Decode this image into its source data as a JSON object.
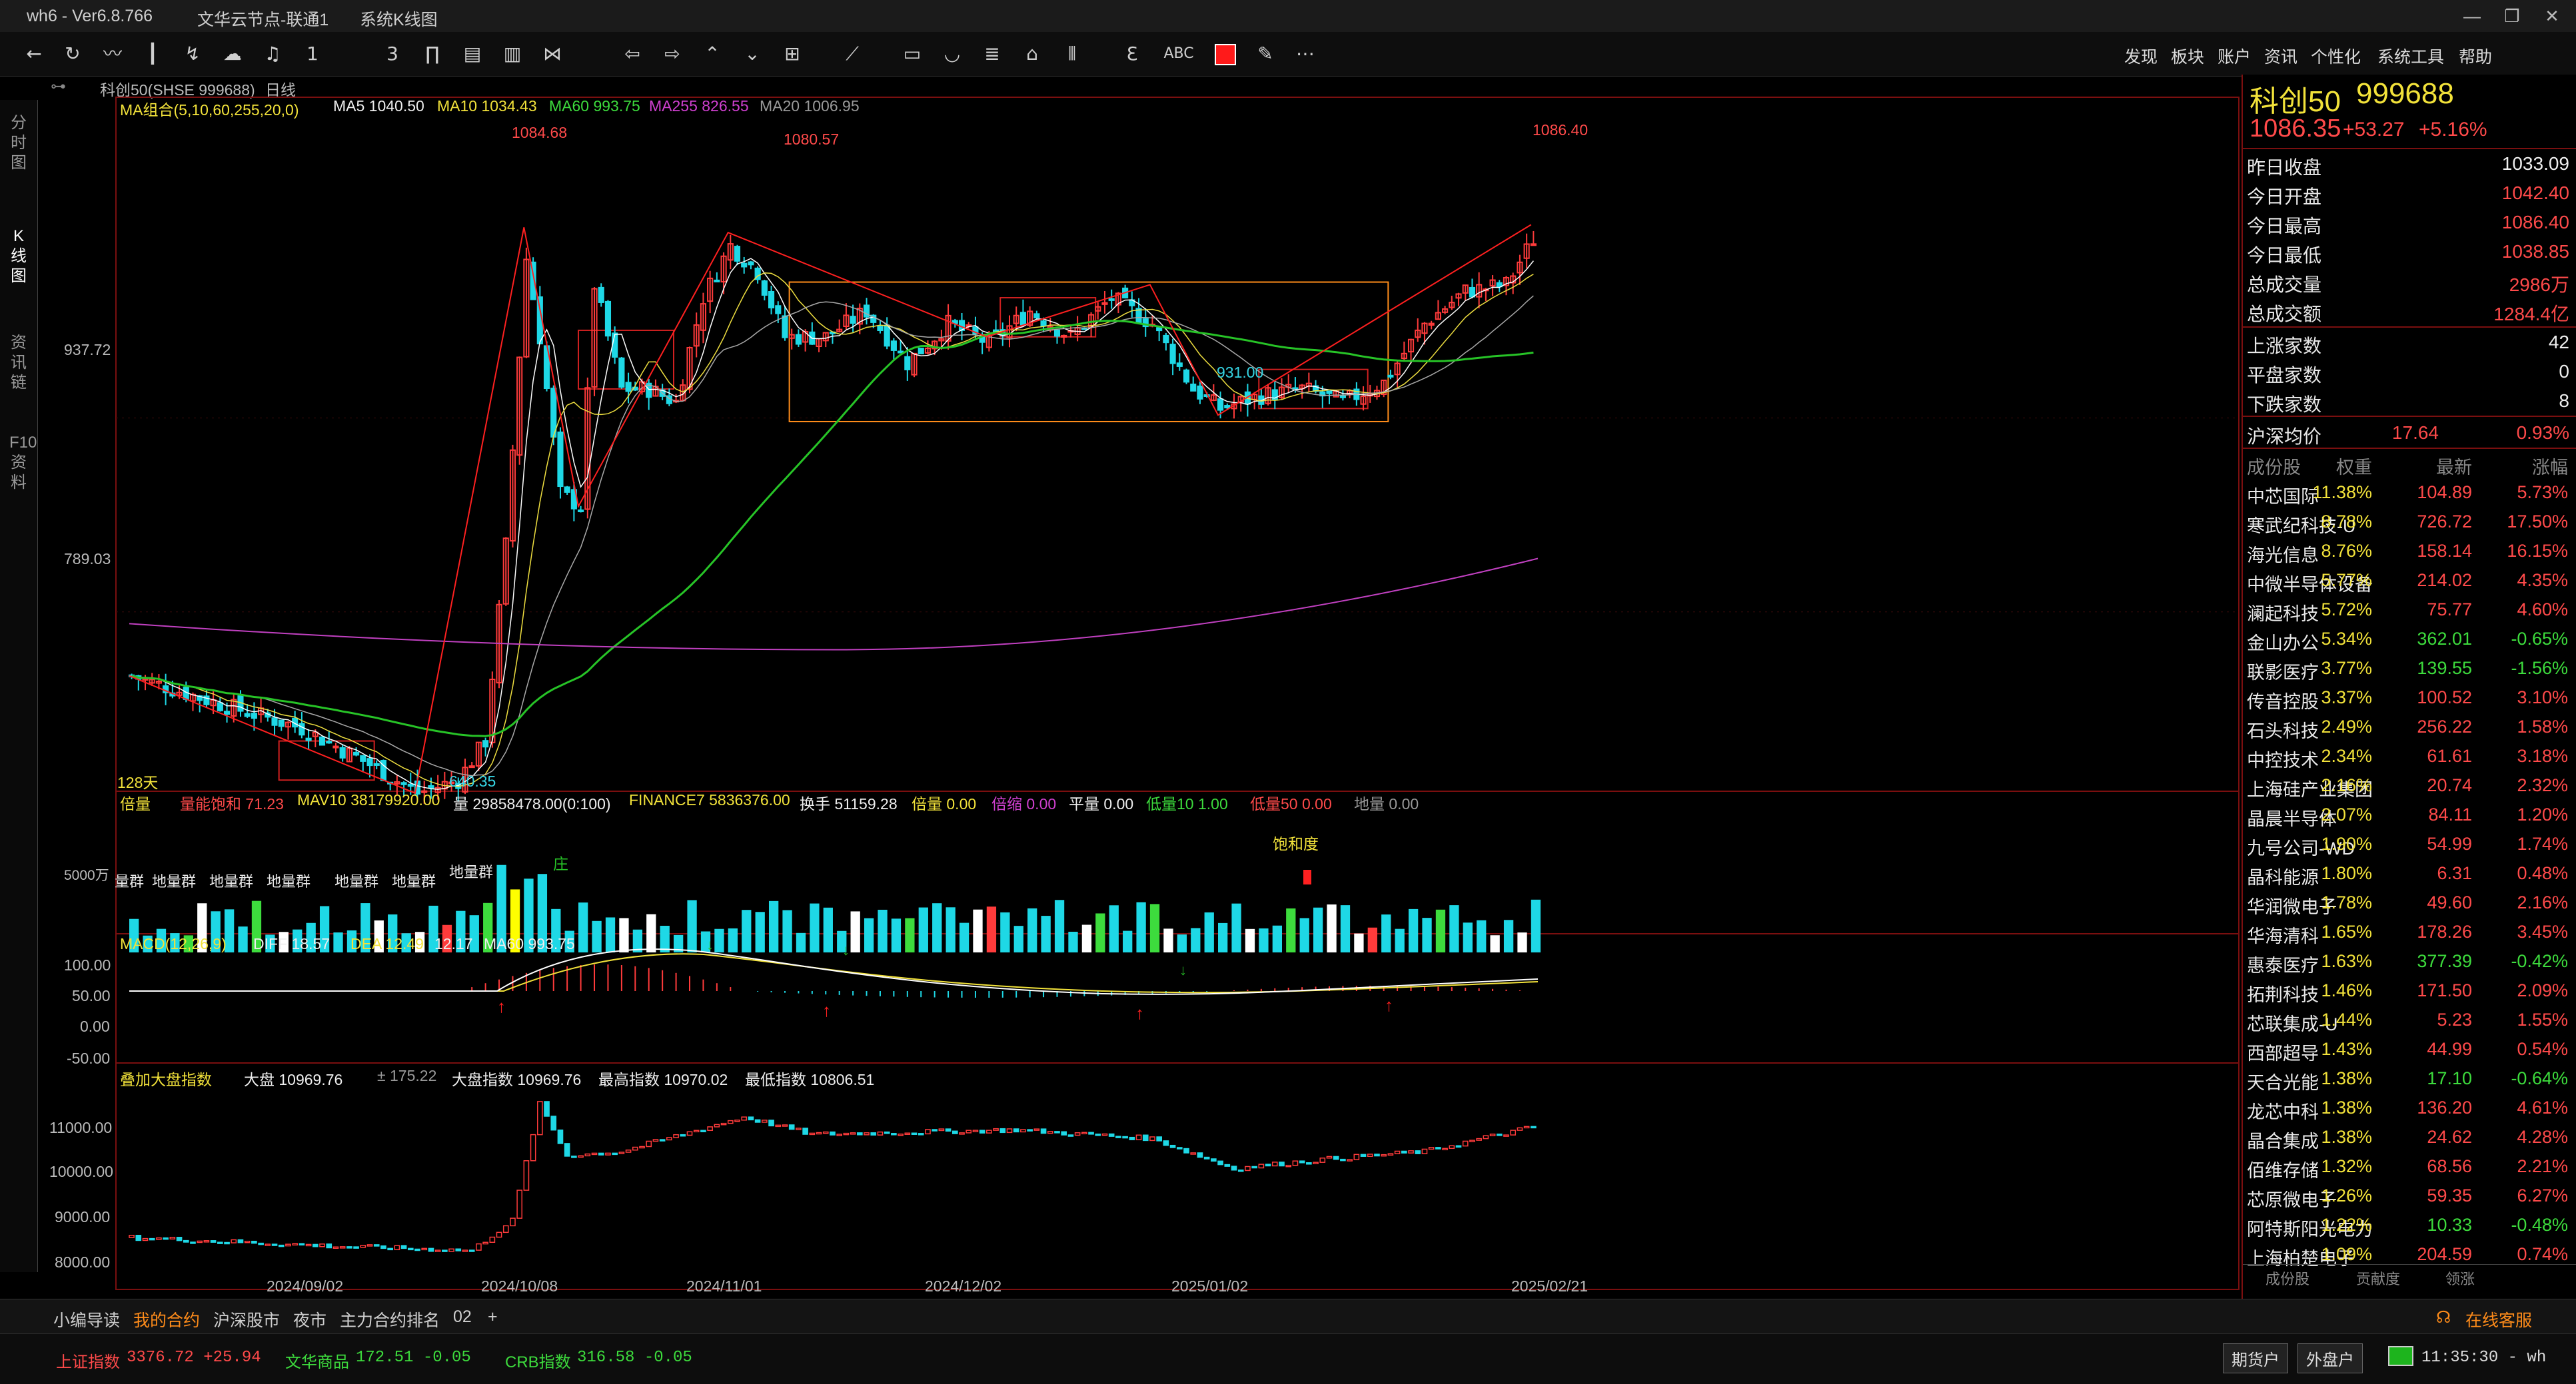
{
  "titlebar": {
    "app": "wh6 - Ver6.8.766",
    "node": "文华云节点-联通1",
    "module": "系统K线图",
    "controls": [
      "—",
      "❐",
      "✕"
    ]
  },
  "toolbar": {
    "icons": [
      "back-icon",
      "refresh-icon",
      "line-icon",
      "candle-icon",
      "tick-icon",
      "cloud-icon",
      "bell-icon",
      "num1-icon",
      "num3-icon",
      "period-icon",
      "season-icon",
      "year-icon",
      "expand-icon",
      "arrow-left-icon",
      "arrow-right-icon",
      "arrow-up-icon",
      "arrow-down-icon",
      "crosshair-icon",
      "draw-line-icon",
      "rect-icon",
      "arc-icon",
      "ruler-icon",
      "home-icon",
      "bars-icon",
      "text-e-icon",
      "abc-icon",
      "color-icon",
      "eraser-icon",
      "more-icon"
    ],
    "menu": [
      "发现",
      "板块",
      "账户",
      "资讯",
      "个性化",
      "系统工具",
      "帮助"
    ]
  },
  "left_tabs": [
    "分时图",
    "K线图",
    "资讯链",
    "F10资料"
  ],
  "chart_header": {
    "symbol": "科创50(SHSE 999688)",
    "period": "日线",
    "ma_group": "MA组合(5,10,60,255,20,0)",
    "ma5": "MA5 1040.50",
    "ma10": "MA10 1034.43",
    "ma60": "MA60 993.75",
    "ma255": "MA255 826.55",
    "ma20": "MA20 1006.95"
  },
  "price_axis": [
    "937.72",
    "789.03"
  ],
  "annotations": {
    "high1": "1084.68",
    "high2": "1080.57",
    "high3": "1086.40",
    "low1": "931.00",
    "low2": "640.35",
    "days": "128天"
  },
  "volume_header": {
    "name": "倍量",
    "a": "量能饱和 71.23",
    "b": "MAV10 38179920.00",
    "c": "量 29858478.00(0:100)",
    "d": "FINANCE7 5836376.00",
    "e": "换手 51159.28",
    "f": "倍量 0.00",
    "g": "倍缩 0.00",
    "h": "平量 0.00",
    "i": "低量10 1.00",
    "j": "低量50 0.00",
    "k": "地量 0.00",
    "axis": "5000万",
    "sat": "饱和度",
    "groups": [
      "量群",
      "地量群",
      "地量群",
      "地量群",
      "地量群",
      "地量群",
      "地量群"
    ],
    "zhuang": "庄"
  },
  "macd_header": {
    "name": "MACD(12,26,9)",
    "diff": "DIFF 18.57",
    "dea": "DEA 12.49",
    "val": "12.17",
    "ma60": "MA60 993.75",
    "axis": [
      "100.00",
      "50.00",
      "0.00",
      "-50.00"
    ]
  },
  "index_header": {
    "name": "叠加大盘指数",
    "a": "大盘 10969.76",
    "b": "± 175.22",
    "c": "大盘指数 10969.76",
    "d": "最高指数 10970.02",
    "e": "最低指数 10806.51",
    "axis": [
      "11000.00",
      "10000.00",
      "9000.00",
      "8000.00"
    ]
  },
  "dates": [
    "2024/09/02",
    "2024/10/08",
    "2024/11/01",
    "2024/12/02",
    "2025/01/02",
    "2025/02/21"
  ],
  "quote": {
    "name": "科创50",
    "code": "999688",
    "price": "1086.35",
    "change": "+53.27",
    "pct": "+5.16%",
    "rows": [
      {
        "k": "昨日收盘",
        "v": "1033.09",
        "cls": "white"
      },
      {
        "k": "今日开盘",
        "v": "1042.40",
        "cls": "red"
      },
      {
        "k": "今日最高",
        "v": "1086.40",
        "cls": "red"
      },
      {
        "k": "今日最低",
        "v": "1038.85",
        "cls": "red"
      },
      {
        "k": "总成交量",
        "v": "2986万",
        "cls": "red"
      },
      {
        "k": "总成交额",
        "v": "1284.4亿",
        "cls": "red"
      }
    ],
    "rows2": [
      {
        "k": "上涨家数",
        "v": "42",
        "cls": "white"
      },
      {
        "k": "平盘家数",
        "v": "0",
        "cls": "white"
      },
      {
        "k": "下跌家数",
        "v": "8",
        "cls": "white"
      }
    ],
    "avg_label": "沪深均价",
    "avg_price": "17.64",
    "avg_pct": "0.93%"
  },
  "components_header": [
    "成份股",
    "权重",
    "最新",
    "涨幅"
  ],
  "components": [
    {
      "n": "中芯国际",
      "w": "11.38%",
      "p": "104.89",
      "c": "5.73%",
      "up": true
    },
    {
      "n": "寒武纪科技-U",
      "w": "8.78%",
      "p": "726.72",
      "c": "17.50%",
      "up": true
    },
    {
      "n": "海光信息",
      "w": "8.76%",
      "p": "158.14",
      "c": "16.15%",
      "up": true
    },
    {
      "n": "中微半导体设备",
      "w": "5.77%",
      "p": "214.02",
      "c": "4.35%",
      "up": true
    },
    {
      "n": "澜起科技",
      "w": "5.72%",
      "p": "75.77",
      "c": "4.60%",
      "up": true
    },
    {
      "n": "金山办公",
      "w": "5.34%",
      "p": "362.01",
      "c": "-0.65%",
      "up": false
    },
    {
      "n": "联影医疗",
      "w": "3.77%",
      "p": "139.55",
      "c": "-1.56%",
      "up": false
    },
    {
      "n": "传音控股",
      "w": "3.37%",
      "p": "100.52",
      "c": "3.10%",
      "up": true
    },
    {
      "n": "石头科技",
      "w": "2.49%",
      "p": "256.22",
      "c": "1.58%",
      "up": true
    },
    {
      "n": "中控技术",
      "w": "2.34%",
      "p": "61.61",
      "c": "3.18%",
      "up": true
    },
    {
      "n": "上海硅产业集团",
      "w": "2.16%",
      "p": "20.74",
      "c": "2.32%",
      "up": true
    },
    {
      "n": "晶晨半导体",
      "w": "2.07%",
      "p": "84.11",
      "c": "1.20%",
      "up": true
    },
    {
      "n": "九号公司-WD",
      "w": "1.90%",
      "p": "54.99",
      "c": "1.74%",
      "up": true
    },
    {
      "n": "晶科能源",
      "w": "1.80%",
      "p": "6.31",
      "c": "0.48%",
      "up": true
    },
    {
      "n": "华润微电子",
      "w": "1.78%",
      "p": "49.60",
      "c": "2.16%",
      "up": true
    },
    {
      "n": "华海清科",
      "w": "1.65%",
      "p": "178.26",
      "c": "3.45%",
      "up": true
    },
    {
      "n": "惠泰医疗",
      "w": "1.63%",
      "p": "377.39",
      "c": "-0.42%",
      "up": false
    },
    {
      "n": "拓荆科技",
      "w": "1.46%",
      "p": "171.50",
      "c": "2.09%",
      "up": true
    },
    {
      "n": "芯联集成-U",
      "w": "1.44%",
      "p": "5.23",
      "c": "1.55%",
      "up": true
    },
    {
      "n": "西部超导",
      "w": "1.43%",
      "p": "44.99",
      "c": "0.54%",
      "up": true
    },
    {
      "n": "天合光能",
      "w": "1.38%",
      "p": "17.10",
      "c": "-0.64%",
      "up": false
    },
    {
      "n": "龙芯中科",
      "w": "1.38%",
      "p": "136.20",
      "c": "4.61%",
      "up": true
    },
    {
      "n": "晶合集成",
      "w": "1.38%",
      "p": "24.62",
      "c": "4.28%",
      "up": true
    },
    {
      "n": "佰维存储",
      "w": "1.32%",
      "p": "68.56",
      "c": "2.21%",
      "up": true
    },
    {
      "n": "芯原微电子",
      "w": "1.26%",
      "p": "59.35",
      "c": "6.27%",
      "up": true
    },
    {
      "n": "阿特斯阳光电力",
      "w": "1.22%",
      "p": "10.33",
      "c": "-0.48%",
      "up": false
    },
    {
      "n": "上海柏楚电子",
      "w": "1.09%",
      "p": "204.59",
      "c": "0.74%",
      "up": true
    }
  ],
  "panel_tabs": [
    "成份股",
    "贡献度",
    "领涨"
  ],
  "bottom_tabs": [
    "小编导读",
    "我的合约",
    "沪深股市",
    "夜市",
    "主力合约排名",
    "02",
    "+"
  ],
  "service": "在线客服",
  "status": {
    "sh_name": "上证指数",
    "sh_val": "3376.72 +25.94",
    "wh_name": "文华商品",
    "wh_val": "172.51 -0.05",
    "crb_name": "CRB指数",
    "crb_val": "316.58 -0.05",
    "btn1": "期货户",
    "btn2": "外盘户",
    "time": "11:35:30 - wh"
  },
  "colors": {
    "up": "#ff3b3b",
    "down": "#1ed8e6",
    "ma5": "#ffffff",
    "ma10": "#f0e040",
    "ma60": "#27c427",
    "ma255": "#c040c0",
    "ma20": "#aaaaaa",
    "box": "#ff8c1a"
  }
}
